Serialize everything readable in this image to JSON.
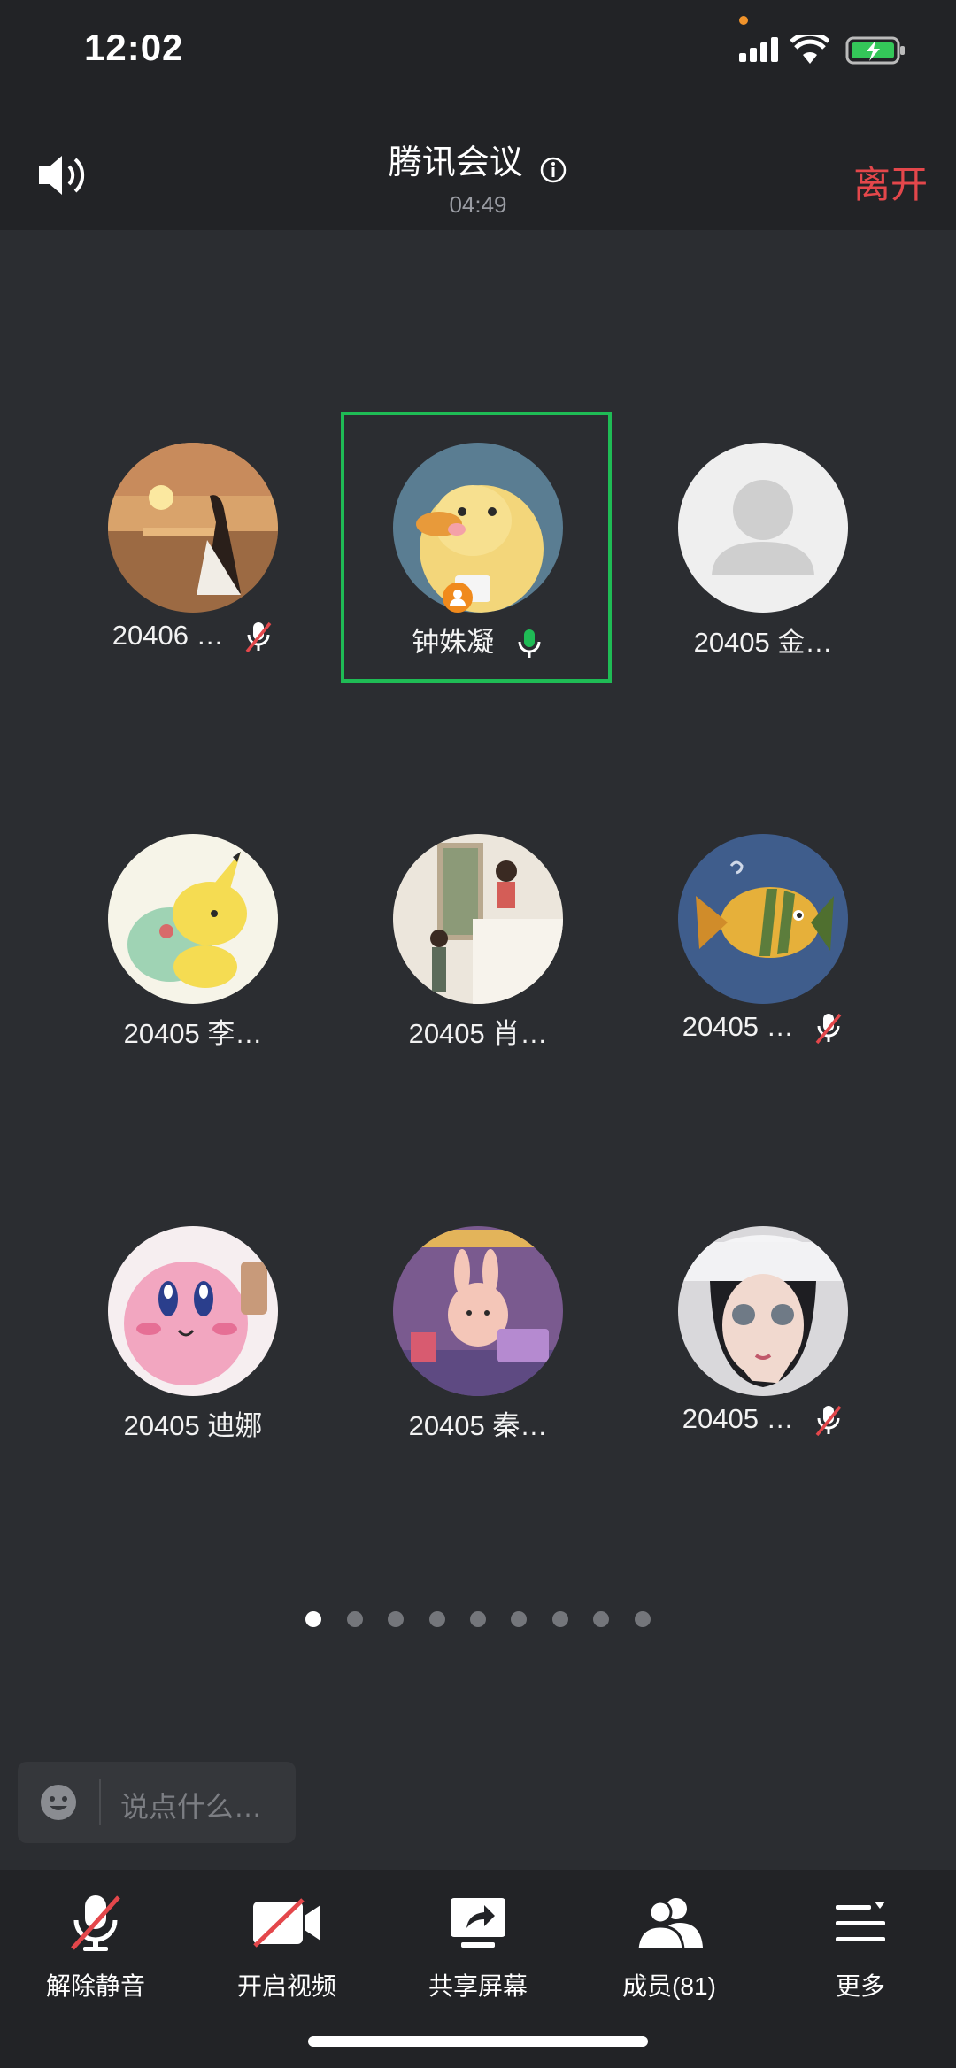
{
  "status_bar": {
    "time": "12:02"
  },
  "header": {
    "title": "腾讯会议",
    "duration": "04:49",
    "leave_label": "离开"
  },
  "participants": [
    {
      "name": "20406 …",
      "muted": true
    },
    {
      "name": "钟姝凝",
      "speaking": true,
      "host": true
    },
    {
      "name": "20405 金…"
    },
    {
      "name": "20405 李…"
    },
    {
      "name": "20405 肖…"
    },
    {
      "name": "20405 …",
      "muted": true
    },
    {
      "name": "20405 迪娜"
    },
    {
      "name": "20405 秦…"
    },
    {
      "name": "20405 …",
      "muted": true
    }
  ],
  "pagination": {
    "pages": 9,
    "current": 1
  },
  "chat": {
    "placeholder": "说点什么…"
  },
  "toolbar": {
    "unmute_label": "解除静音",
    "video_label": "开启视频",
    "share_label": "共享屏幕",
    "members_label": "成员(81)",
    "more_label": "更多"
  },
  "colors": {
    "accent_green": "#1fbb55",
    "leave_red": "#e4474b",
    "host_orange": "#f08a1c",
    "background": "#2b2d31"
  }
}
